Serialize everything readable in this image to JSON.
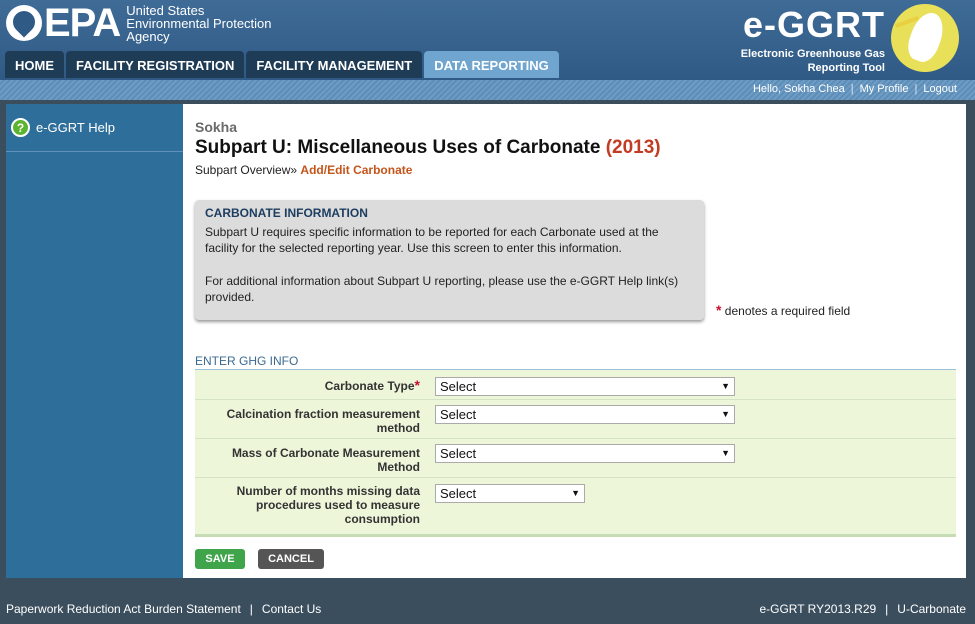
{
  "header": {
    "epa_text": "EPA",
    "epa_line1": "United States",
    "epa_line2": "Environmental Protection",
    "epa_line3": "Agency",
    "app_title": "e-GGRT",
    "app_sub1": "Electronic Greenhouse Gas",
    "app_sub2": "Reporting Tool"
  },
  "nav": {
    "tabs": [
      "HOME",
      "FACILITY REGISTRATION",
      "FACILITY MANAGEMENT",
      "DATA REPORTING"
    ],
    "active": "DATA REPORTING"
  },
  "user": {
    "greeting": "Hello, Sokha Chea",
    "my_profile": "My Profile",
    "logout": "Logout"
  },
  "sidebar": {
    "items": [
      {
        "label": "e-GGRT Help",
        "icon": "help-icon"
      }
    ]
  },
  "page": {
    "facility": "Sokha",
    "title": "Subpart U: Miscellaneous Uses of Carbonate",
    "year": "(2013)",
    "breadcrumb_parent": "Subpart Overview",
    "breadcrumb_sep": "»",
    "breadcrumb_current": "Add/Edit Carbonate"
  },
  "info": {
    "heading": "CARBONATE INFORMATION",
    "para1": "Subpart U requires specific information to be reported for each Carbonate used at the facility for the selected reporting year. Use this screen to enter this information.",
    "para2": "For additional information about Subpart U reporting, please use the e-GGRT Help link(s) provided."
  },
  "required_note": "denotes a required field",
  "form": {
    "section": "ENTER GHG INFO",
    "fields": [
      {
        "label": "Carbonate Type",
        "value": "Select",
        "required": true
      },
      {
        "label": "Calcination fraction measurement method",
        "value": "Select",
        "required": false
      },
      {
        "label": "Mass of Carbonate Measurement Method",
        "value": "Select",
        "required": false
      },
      {
        "label": "Number of months missing data procedures used to measure consumption",
        "value": "Select",
        "required": false
      }
    ]
  },
  "buttons": {
    "save": "SAVE",
    "cancel": "CANCEL"
  },
  "footer": {
    "paperwork": "Paperwork Reduction Act Burden Statement",
    "contact": "Contact Us",
    "version": "e-GGRT RY2013.R29",
    "screen": "U-Carbonate"
  },
  "colors": {
    "header": "#3a6590",
    "sidebar": "#2e6e9a",
    "active_tab": "#6fa5cf",
    "year": "#c23b22",
    "save": "#3fa44a"
  }
}
